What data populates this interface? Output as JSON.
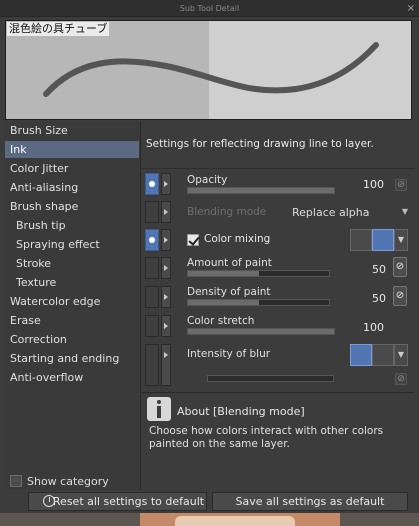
{
  "window": {
    "title": "Sub Tool Detail"
  },
  "preview": {
    "tool_name": "混色絵の具チューブ"
  },
  "sidebar": {
    "items": [
      {
        "label": "Brush Size",
        "sub": false,
        "active": false
      },
      {
        "label": "Ink",
        "sub": false,
        "active": true
      },
      {
        "label": "Color Jitter",
        "sub": false,
        "active": false
      },
      {
        "label": "Anti-aliasing",
        "sub": false,
        "active": false
      },
      {
        "label": "Brush shape",
        "sub": false,
        "active": false
      },
      {
        "label": "Brush tip",
        "sub": true,
        "active": false
      },
      {
        "label": "Spraying effect",
        "sub": true,
        "active": false
      },
      {
        "label": "Stroke",
        "sub": true,
        "active": false
      },
      {
        "label": "Texture",
        "sub": true,
        "active": false
      },
      {
        "label": "Watercolor edge",
        "sub": false,
        "active": false
      },
      {
        "label": "Erase",
        "sub": false,
        "active": false
      },
      {
        "label": "Correction",
        "sub": false,
        "active": false
      },
      {
        "label": "Starting and ending",
        "sub": false,
        "active": false
      },
      {
        "label": "Anti-overflow",
        "sub": false,
        "active": false
      }
    ],
    "show_category": "Show category"
  },
  "main": {
    "header": "Settings for reflecting drawing line to layer.",
    "opacity": {
      "label": "Opacity",
      "value": "100",
      "fill_fraction": 1.0
    },
    "blending": {
      "label": "Blending mode",
      "value": "Replace alpha"
    },
    "color_mixing": {
      "label": "Color mixing",
      "checked": true
    },
    "amount": {
      "label": "Amount of paint",
      "value": "50",
      "fill_fraction": 0.5
    },
    "density": {
      "label": "Density of paint",
      "value": "50",
      "fill_fraction": 0.5
    },
    "stretch": {
      "label": "Color stretch",
      "value": "100",
      "fill_fraction": 1.0
    },
    "blur": {
      "label": "Intensity of blur"
    },
    "info": {
      "title": "About [Blending mode]",
      "description": "Choose how colors interact with other colors painted on the same layer."
    }
  },
  "footer": {
    "reset": "Reset all settings to default",
    "save": "Save all settings as default"
  },
  "colors": {
    "accent": "#5276b3",
    "selected_row": "#5a6a82",
    "panel": "#3c3c3c"
  }
}
